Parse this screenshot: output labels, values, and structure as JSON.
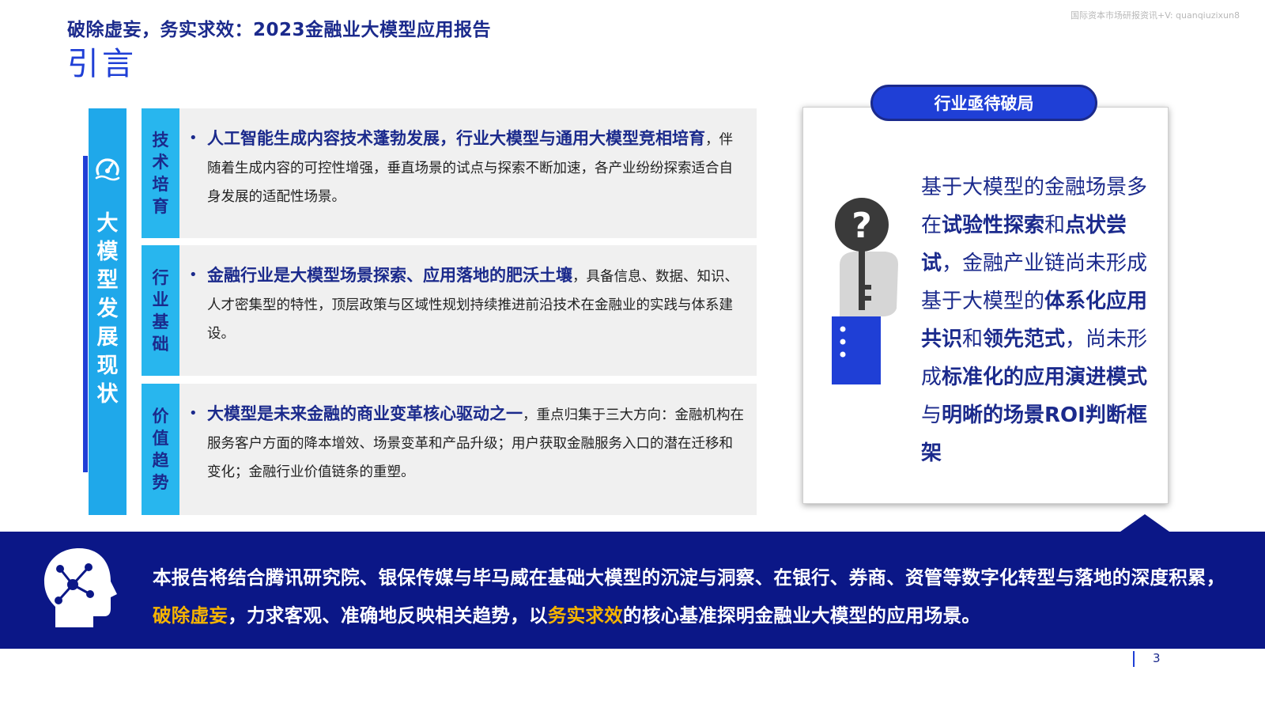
{
  "header": {
    "doc_title": "破除虚妄，务实求效：2023金融业大模型应用报告",
    "section_title": "引言",
    "watermark": "国际资本市场研报资讯+V: quanqiuzixun8"
  },
  "banner": {
    "label": "大模型发展现状",
    "icon": "dashboard-gauge-icon"
  },
  "rows": [
    {
      "label": "技术培育",
      "bold": "人工智能生成内容技术蓬勃发展，行业大模型与通用大模型竞相培育",
      "text": "，伴随着生成内容的可控性增强，垂直场景的试点与探索不断加速，各产业纷纷探索适合自身发展的适配性场景。"
    },
    {
      "label": "行业基础",
      "bold": "金融行业是大模型场景探索、应用落地的肥沃土壤",
      "text": "，具备信息、数据、知识、人才密集型的特性，顶层政策与区域性规划持续推进前沿技术在金融业的实践与体系建设。"
    },
    {
      "label": "价值趋势",
      "bold": "大模型是未来金融的商业变革核心驱动之一",
      "text": "，重点归集于三大方向：金融机构在服务客户方面的降本增效、场景变革和产品升级；用户获取金融服务入口的潜在迁移和变化；金融行业价值链条的重塑。"
    }
  ],
  "card": {
    "pill": "行业亟待破局",
    "icon": "question-key-icon",
    "segments": [
      {
        "t": "基于大模型的金融场景多在",
        "b": false
      },
      {
        "t": "试验性探索",
        "b": true
      },
      {
        "t": "和",
        "b": false
      },
      {
        "t": "点状尝试",
        "b": true
      },
      {
        "t": "，金融产业链尚未形成基于大模型的",
        "b": false
      },
      {
        "t": "体系化应用共识",
        "b": true
      },
      {
        "t": "和",
        "b": false
      },
      {
        "t": "领先范式",
        "b": true
      },
      {
        "t": "，尚未形成",
        "b": false
      },
      {
        "t": "标准化的应用演进模式",
        "b": true
      },
      {
        "t": "与",
        "b": false
      },
      {
        "t": "明晰的场景ROI判断框架",
        "b": true
      }
    ]
  },
  "band": {
    "icon": "head-network-icon",
    "text1": "本报告将结合腾讯研究院、银保传媒与毕马威在基础大模型的沉淀与洞察、在银行、券商、资管等数字化转型与落地的深度积累，",
    "highlight1": "破除虚妄",
    "text2": "，力求客观、准确地反映相关趋势，以",
    "highlight2": "务实求效",
    "text3": "的核心基准探明金融业大模型的应用场景。"
  },
  "page": {
    "number": "3"
  },
  "colors": {
    "navy": "#1b2a8c",
    "blue": "#1f3fd6",
    "cyan": "#1fa8ea",
    "band": "#0b1787",
    "highlight": "#f6b400"
  }
}
